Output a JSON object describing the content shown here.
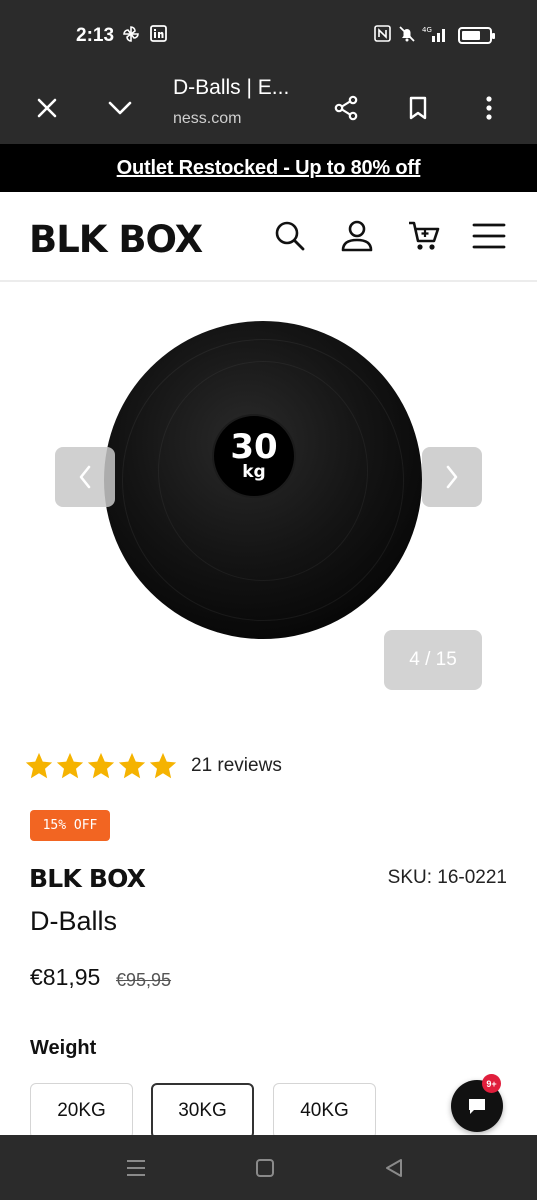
{
  "status_bar": {
    "time": "2:13"
  },
  "browser": {
    "page_title": "D-Balls | E...",
    "url": "ness.com"
  },
  "promo": {
    "text": "Outlet Restocked - Up to 80% off"
  },
  "header": {
    "logo": "BLK BOX"
  },
  "gallery": {
    "image_label_number": "30",
    "image_label_unit": "kg",
    "counter": "4 / 15"
  },
  "product": {
    "rating": 5,
    "reviews": "21 reviews",
    "discount_badge": "15% OFF",
    "brand": "BLK BOX",
    "sku": "SKU: 16-0221",
    "name": "D-Balls",
    "price": "€81,95",
    "old_price": "€95,95",
    "weight_label": "Weight",
    "weights": [
      "20KG",
      "30KG",
      "40KG"
    ],
    "selected_weight": "30KG"
  },
  "chat": {
    "badge": "9+"
  },
  "colors": {
    "accent": "#f26522",
    "star": "#f5b301",
    "chrome": "#2b2b2b"
  }
}
